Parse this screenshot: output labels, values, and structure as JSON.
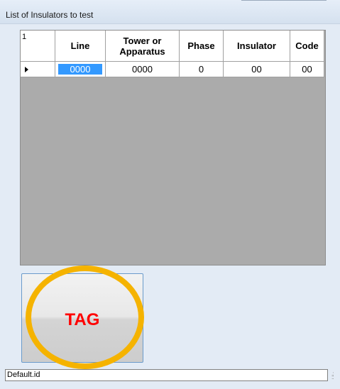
{
  "window": {
    "title": "List of Insulators to test"
  },
  "grid": {
    "corner_label": "1",
    "columns": [
      {
        "key": "line",
        "label": "Line"
      },
      {
        "key": "tower",
        "label": "Tower or Apparatus"
      },
      {
        "key": "phase",
        "label": "Phase"
      },
      {
        "key": "insulator",
        "label": "Insulator"
      },
      {
        "key": "code",
        "label": "Code"
      }
    ],
    "rows": [
      {
        "line": "0000",
        "tower": "0000",
        "phase": "0",
        "insulator": "00",
        "code": "00"
      }
    ],
    "selected_cell": {
      "row": 0,
      "column": "line"
    }
  },
  "buttons": {
    "tag_label": "TAG"
  },
  "status": {
    "text": "Default.id"
  },
  "colors": {
    "selection": "#3399ff",
    "tag_text": "#ff0000",
    "highlight_ring": "#f5b300"
  },
  "icons": {
    "row_indicator": "current-row-arrow-icon",
    "resize_grip": "resize-grip-icon"
  }
}
